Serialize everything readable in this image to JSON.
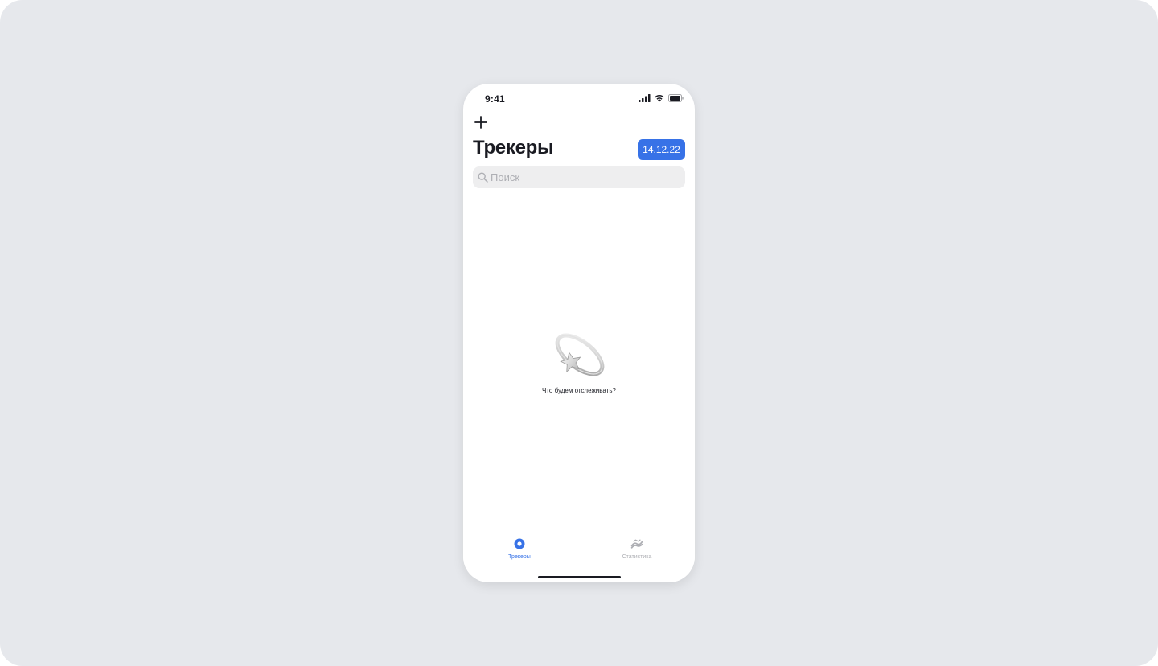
{
  "status_bar": {
    "time": "9:41",
    "icons": [
      "cellular-signal-icon",
      "wifi-icon",
      "battery-icon"
    ]
  },
  "header": {
    "add_icon": "plus-icon",
    "title": "Трекеры",
    "date": "14.12.22"
  },
  "search": {
    "placeholder": "Поиск",
    "value": "",
    "icon": "magnifier-icon"
  },
  "empty_state": {
    "icon": "star-orbit-icon",
    "text": "Что будем отслеживать?"
  },
  "tab_bar": {
    "tabs": [
      {
        "label": "Трекеры",
        "icon": "trackers-tab-icon",
        "active": true
      },
      {
        "label": "Статистика",
        "icon": "statistics-tab-icon",
        "active": false
      }
    ]
  },
  "colors": {
    "accent": "#3772e7",
    "text": "#1a1b22",
    "inactive": "#aeafb4",
    "background": "#e6e8ec",
    "search_bg": "#eeeeef"
  }
}
